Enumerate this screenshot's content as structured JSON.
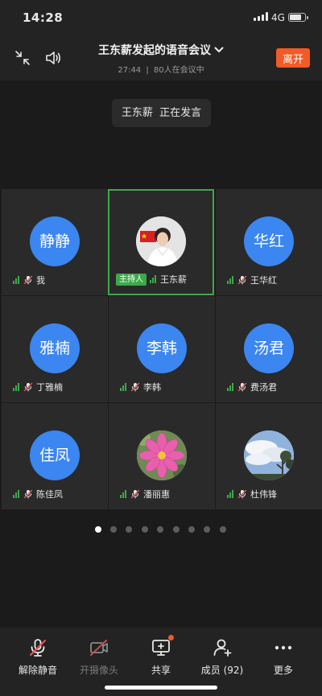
{
  "status": {
    "time": "14:28",
    "network": "4G"
  },
  "header": {
    "title": "王东薪发起的语音会议",
    "duration": "27:44",
    "separator": "|",
    "participants_text": "80人在会议中",
    "leave_label": "离开"
  },
  "speaking": {
    "name": "王东薪",
    "status": "正在发言"
  },
  "participants": [
    {
      "avatar_text": "静静",
      "name": "我",
      "host": false
    },
    {
      "avatar_text": "",
      "name": "王东薪",
      "host": true,
      "host_label": "主持人"
    },
    {
      "avatar_text": "华红",
      "name": "王华红",
      "host": false
    },
    {
      "avatar_text": "雅楠",
      "name": "丁雅楠",
      "host": false
    },
    {
      "avatar_text": "李韩",
      "name": "李韩",
      "host": false
    },
    {
      "avatar_text": "汤君",
      "name": "费汤君",
      "host": false
    },
    {
      "avatar_text": "佳凤",
      "name": "陈佳凤",
      "host": false
    },
    {
      "avatar_text": "",
      "name": "潘丽惠",
      "host": false
    },
    {
      "avatar_text": "",
      "name": "杜伟锋",
      "host": false
    }
  ],
  "pagination": {
    "total_pages": 9,
    "current_page": 1
  },
  "toolbar": {
    "unmute": "解除静音",
    "camera": "开摄像头",
    "share": "共享",
    "members": "成员 (92)",
    "more": "更多"
  },
  "colors": {
    "accent_orange": "#f25a27",
    "avatar_blue": "#3b86f0",
    "active_green": "#3ea94a"
  }
}
